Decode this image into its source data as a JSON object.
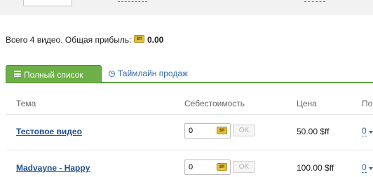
{
  "summary": {
    "text": "Всего 4 видео. Общая прибыль:",
    "currency_icon": "sff-coin-icon",
    "total": "0.00"
  },
  "tabs": {
    "full_list": "Полный список",
    "timeline": "Таймлайн продаж"
  },
  "columns": {
    "topic": "Тема",
    "cost": "Себестоимость",
    "price": "Цена",
    "sales": "По"
  },
  "rows": [
    {
      "title": "Тестовое видео",
      "cost": "0",
      "ok": "OK",
      "price": "50.00 $ff",
      "count": "0"
    },
    {
      "title": "Madvayne - Happy",
      "cost": "0",
      "ok": "OK",
      "price": "100.00 $ff",
      "count": "0"
    }
  ],
  "coin_label": "$ff",
  "colors": {
    "accent_green": "#6cb047",
    "link_blue": "#2d6aa8",
    "coin_gold": "#e6c23c"
  }
}
